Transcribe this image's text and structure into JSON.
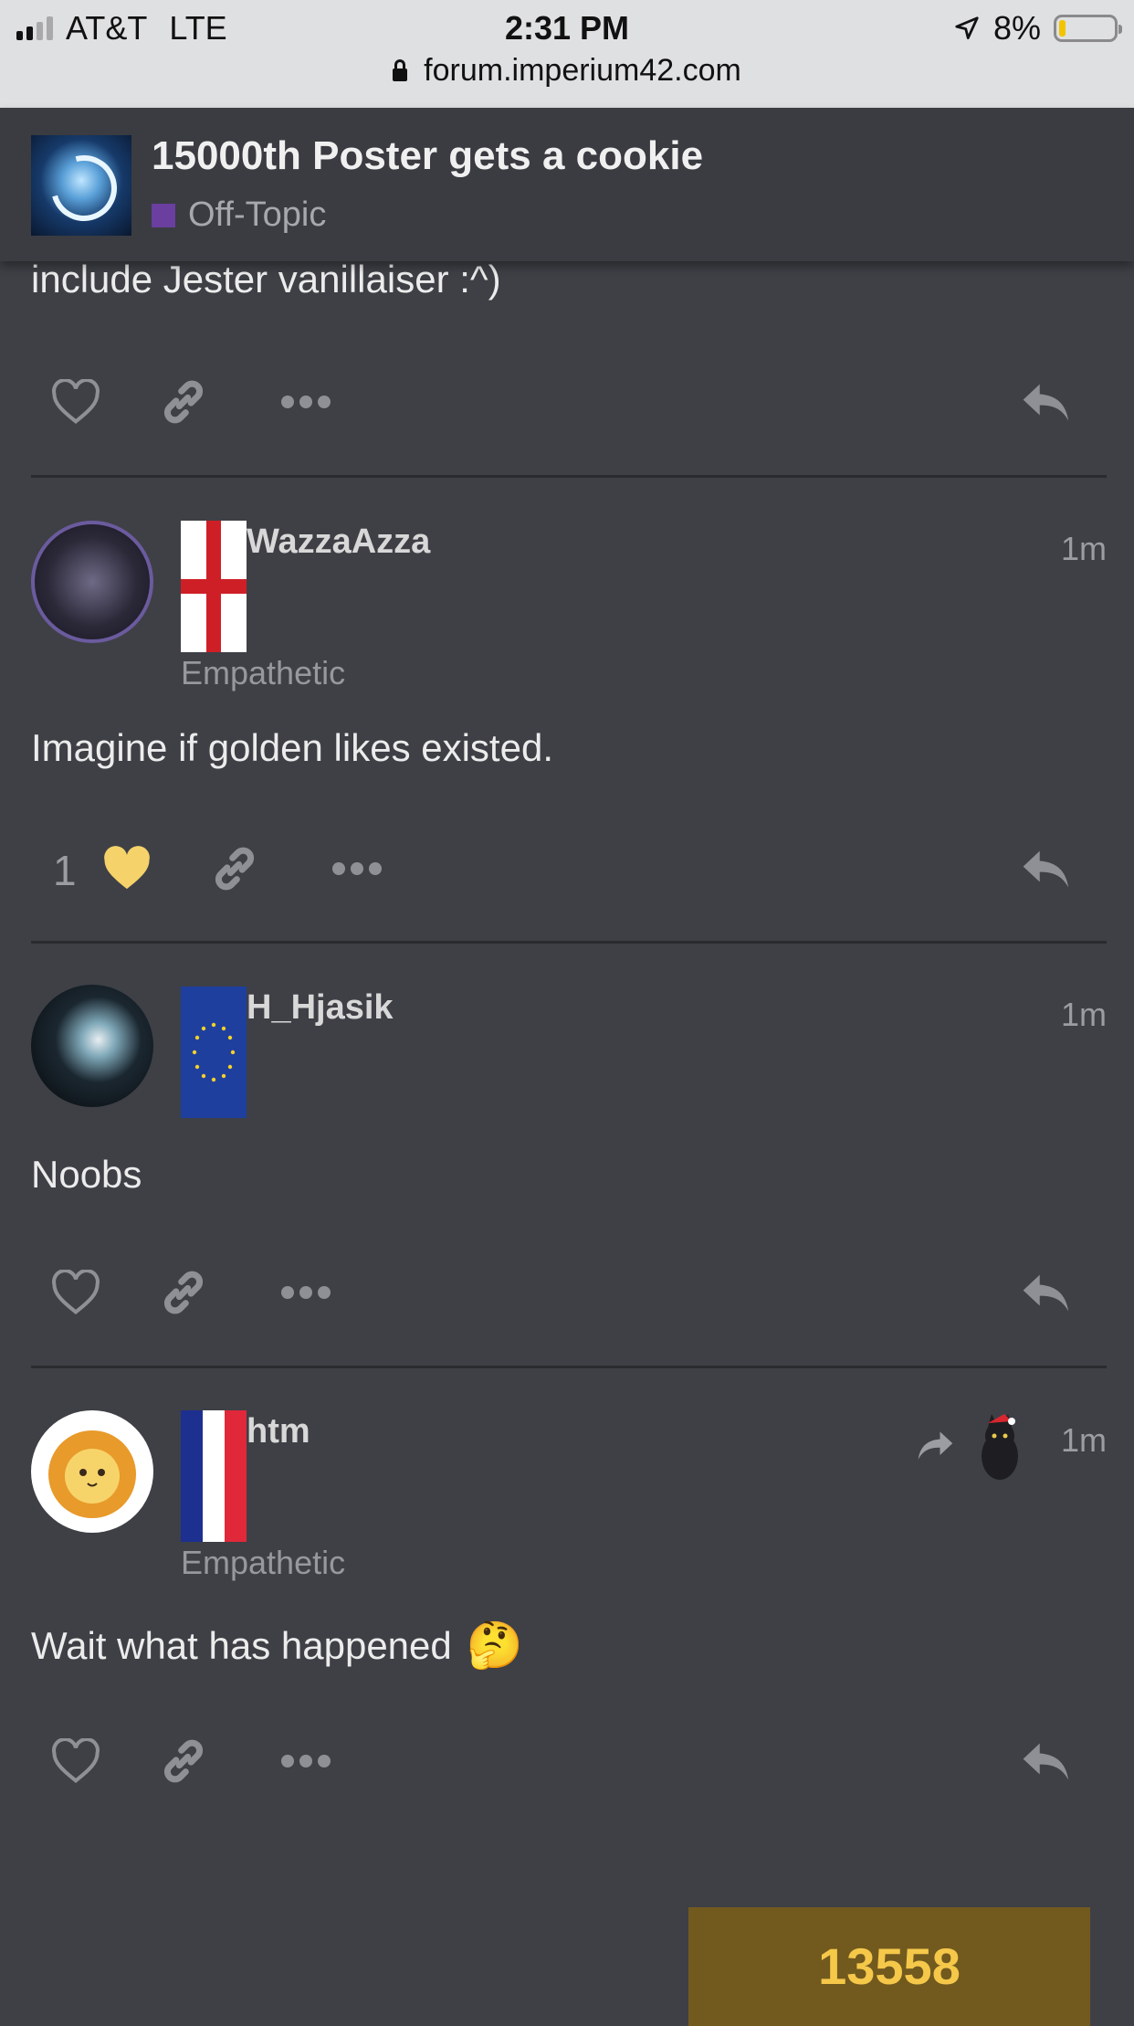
{
  "status": {
    "carrier": "AT&T",
    "network": "LTE",
    "time": "2:31 PM",
    "battery": "8%",
    "url": "forum.imperium42.com"
  },
  "topic": {
    "title": "15000th Poster gets a cookie",
    "category": "Off-Topic",
    "category_color": "#6a3fa0"
  },
  "posts": [
    {
      "text": "include Jester vanillaiser :^)",
      "likes": ""
    },
    {
      "username": "WazzaAzza",
      "user_title": "Empathetic",
      "time": "1m",
      "text": "Imagine if golden likes existed.",
      "likes": "1",
      "flag": "england"
    },
    {
      "username": "H_Hjasik",
      "user_title": "",
      "time": "1m",
      "text": "Noobs",
      "likes": "",
      "flag": "european-union"
    },
    {
      "username": "htm",
      "user_title": "Empathetic",
      "time": "1m",
      "text": "Wait what has happened",
      "emoji": "🤔",
      "likes": "",
      "flag": "france"
    }
  ],
  "progress": {
    "post_number": "13558"
  },
  "colors": {
    "background": "#3e4046",
    "liked_heart": "#f5d26a",
    "progress_bg": "#725a1e",
    "progress_text": "#f5c84a"
  }
}
